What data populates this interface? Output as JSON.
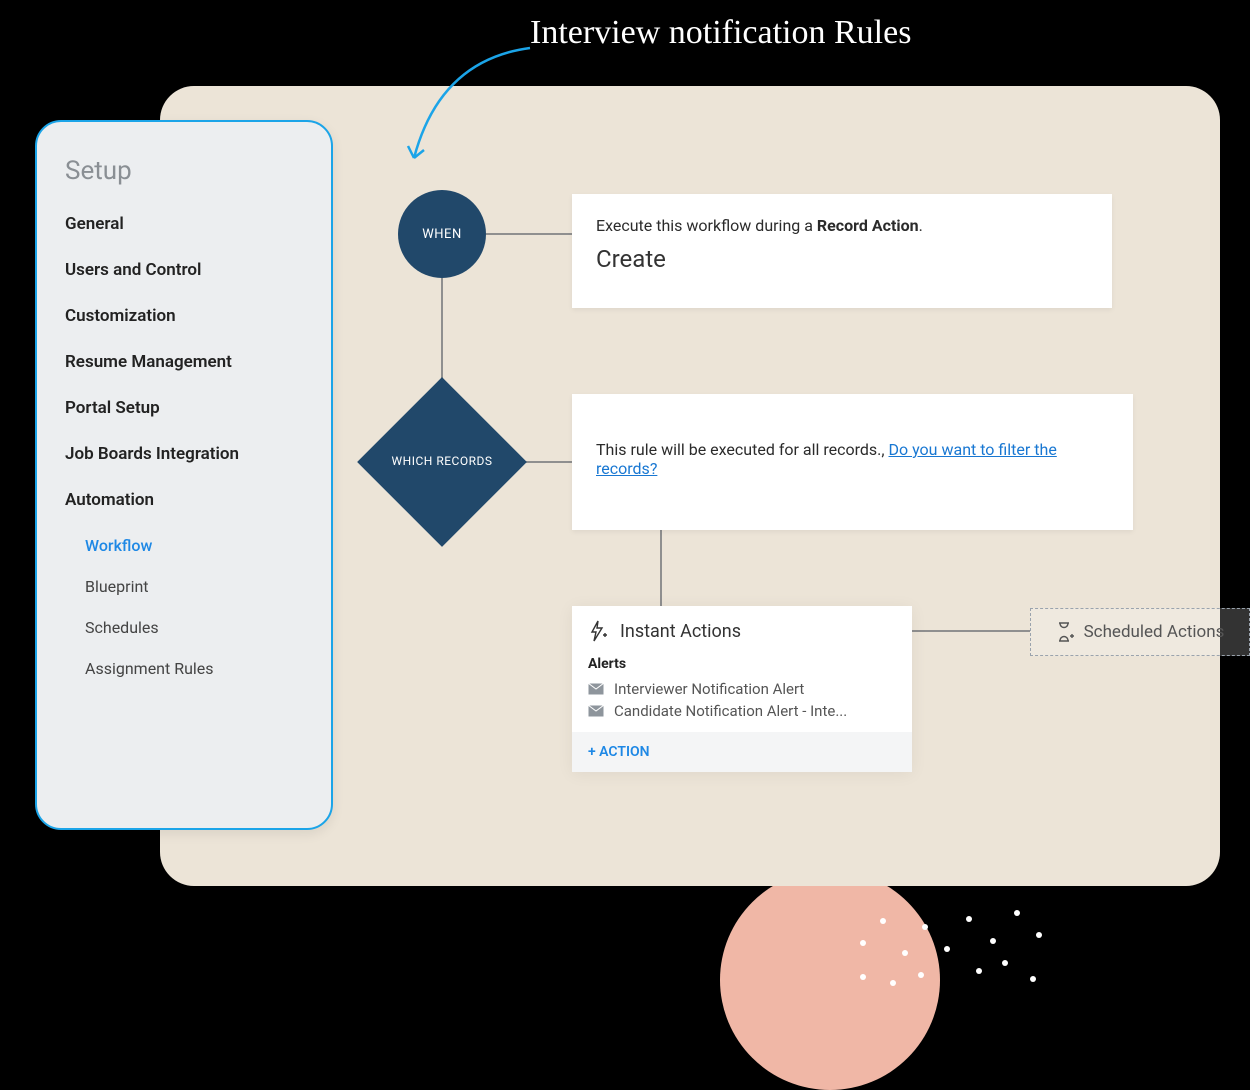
{
  "annotation": "Interview notification Rules",
  "sidebar": {
    "title": "Setup",
    "items": [
      {
        "label": "General"
      },
      {
        "label": "Users and Control"
      },
      {
        "label": "Customization"
      },
      {
        "label": "Resume Management"
      },
      {
        "label": "Portal Setup"
      },
      {
        "label": "Job Boards Integration"
      },
      {
        "label": "Automation"
      }
    ],
    "subitems": [
      {
        "label": "Workflow",
        "active": true
      },
      {
        "label": "Blueprint"
      },
      {
        "label": "Schedules"
      },
      {
        "label": "Assignment Rules"
      }
    ]
  },
  "workflow": {
    "when": {
      "badge": "WHEN",
      "line1_pre": "Execute this workflow during a ",
      "line1_bold": "Record Action",
      "line1_post": ".",
      "line2": "Create"
    },
    "which": {
      "badge": "WHICH RECORDS",
      "text": "This rule will be executed for all records., ",
      "link": "Do you want to filter the records?"
    },
    "instant": {
      "title": "Instant Actions",
      "alerts_title": "Alerts",
      "alerts": [
        "Interviewer Notification Alert",
        "Candidate Notification Alert - Inte..."
      ],
      "add_action": "+ ACTION"
    },
    "scheduled": {
      "title": "Scheduled Actions"
    }
  }
}
